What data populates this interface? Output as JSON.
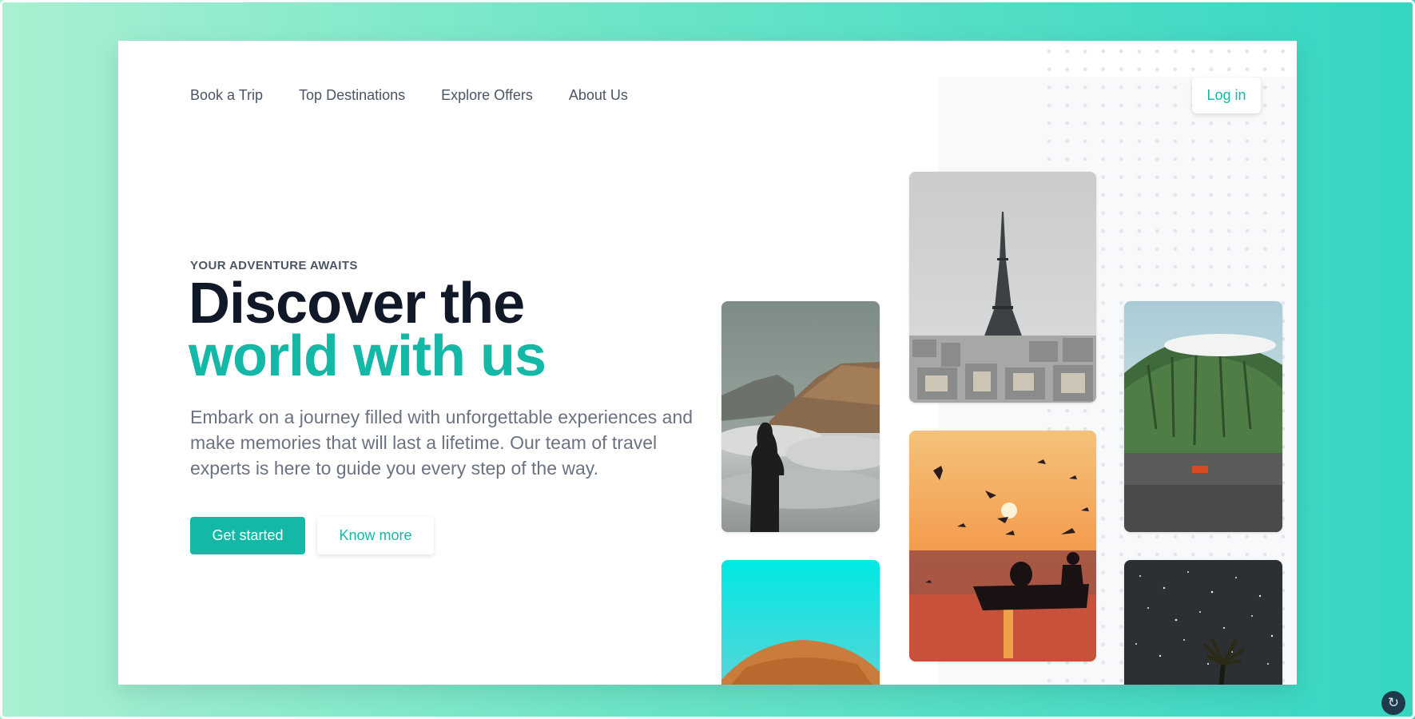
{
  "nav": {
    "items": [
      "Book a Trip",
      "Top Destinations",
      "Explore Offers",
      "About Us"
    ],
    "login_label": "Log in"
  },
  "hero": {
    "eyebrow": "YOUR ADVENTURE AWAITS",
    "headline_line1": "Discover the",
    "headline_line2": "world with us",
    "description": "Embark on a journey filled with unforgettable experiences and make memories that will last a lifetime. Our team of travel experts is here to guide you every step of the way.",
    "primary_cta": "Get started",
    "secondary_cta": "Know more"
  },
  "gallery": [
    {
      "subject": "person-silhouette-mountain-clouds-photo"
    },
    {
      "subject": "desert-dune-cyan-sky-photo"
    },
    {
      "subject": "eiffel-tower-paris-photo"
    },
    {
      "subject": "sunset-birds-boat-photo"
    },
    {
      "subject": "green-mountain-red-car-photo"
    },
    {
      "subject": "starry-night-sky-palm-photo"
    }
  ],
  "colors": {
    "accent": "#14b8a6",
    "heading": "#111827",
    "body_text": "#6b7280",
    "nav_text": "#4b5563",
    "background_gradient_start": "#a9f0d1",
    "background_gradient_end": "#35d6c2"
  },
  "fab_icon": "refresh-icon"
}
